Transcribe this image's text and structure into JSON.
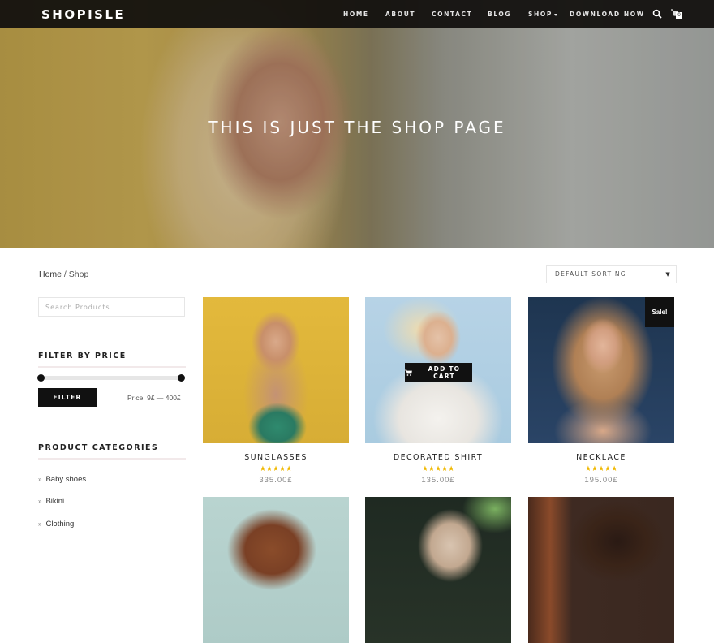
{
  "nav": {
    "logo": "SHOPISLE",
    "items": [
      "HOME",
      "ABOUT",
      "CONTACT",
      "BLOG",
      "SHOP",
      "DOWNLOAD NOW"
    ],
    "cart_count": "0"
  },
  "hero": {
    "title": "THIS IS JUST THE SHOP PAGE"
  },
  "breadcrumb": {
    "home": "Home",
    "separator": " / ",
    "current": "Shop"
  },
  "sidebar": {
    "search_placeholder": "Search Products…",
    "filter_title": "FILTER BY PRICE",
    "filter_button": "FILTER",
    "price_label": "Price: 9£ — 400£",
    "price_min": 9,
    "price_max": 400,
    "categories_title": "PRODUCT CATEGORIES",
    "categories": [
      "Baby shoes",
      "Bikini",
      "Clothing"
    ]
  },
  "sorting": {
    "selected": "DEFAULT SORTING"
  },
  "products": [
    {
      "name": "SUNGLASSES",
      "rating": 5,
      "stars": "★★★★★",
      "price": "335.00£"
    },
    {
      "name": "DECORATED SHIRT",
      "rating": 5,
      "stars": "★★★★★",
      "price": "135.00£",
      "hover_button": "ADD TO CART"
    },
    {
      "name": "NECKLACE",
      "rating": 5,
      "stars": "★★★★★",
      "price": "195.00£",
      "badge": "Sale!"
    }
  ]
}
